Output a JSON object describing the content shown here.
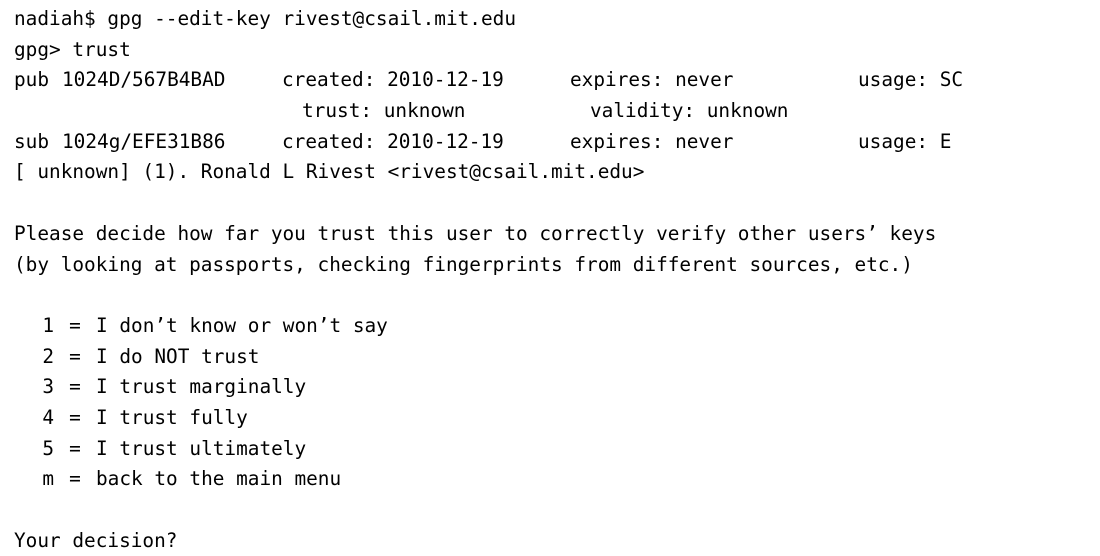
{
  "terminal": {
    "prompt": "nadiah$ gpg --edit-key rivest@csail.mit.edu",
    "gpg_prompt": "gpg> trust",
    "pub": {
      "label": "pub",
      "key": "1024D/567B4BAD",
      "created": "created: 2010-12-19",
      "expires": "expires: never",
      "usage": "usage: SC",
      "trust": "trust: unknown",
      "validity": "validity: unknown"
    },
    "sub": {
      "label": "sub",
      "key": "1024g/EFE31B86",
      "created": "created: 2010-12-19",
      "expires": "expires: never",
      "usage": "usage: E"
    },
    "uid": "[ unknown] (1). Ronald L Rivest <rivest@csail.mit.edu>",
    "question_line1": "Please decide how far you trust this user to correctly verify other users’ keys",
    "question_line2": "(by looking at passports, checking fingerprints from different sources, etc.)",
    "options": [
      {
        "key": "1",
        "label": "I don’t know or won’t say"
      },
      {
        "key": "2",
        "label": "I do NOT trust"
      },
      {
        "key": "3",
        "label": "I trust marginally"
      },
      {
        "key": "4",
        "label": "I trust fully"
      },
      {
        "key": "5",
        "label": "I trust ultimately"
      },
      {
        "key": "m",
        "label": "back to the main menu"
      }
    ],
    "decision_prompt": "Your decision?"
  }
}
